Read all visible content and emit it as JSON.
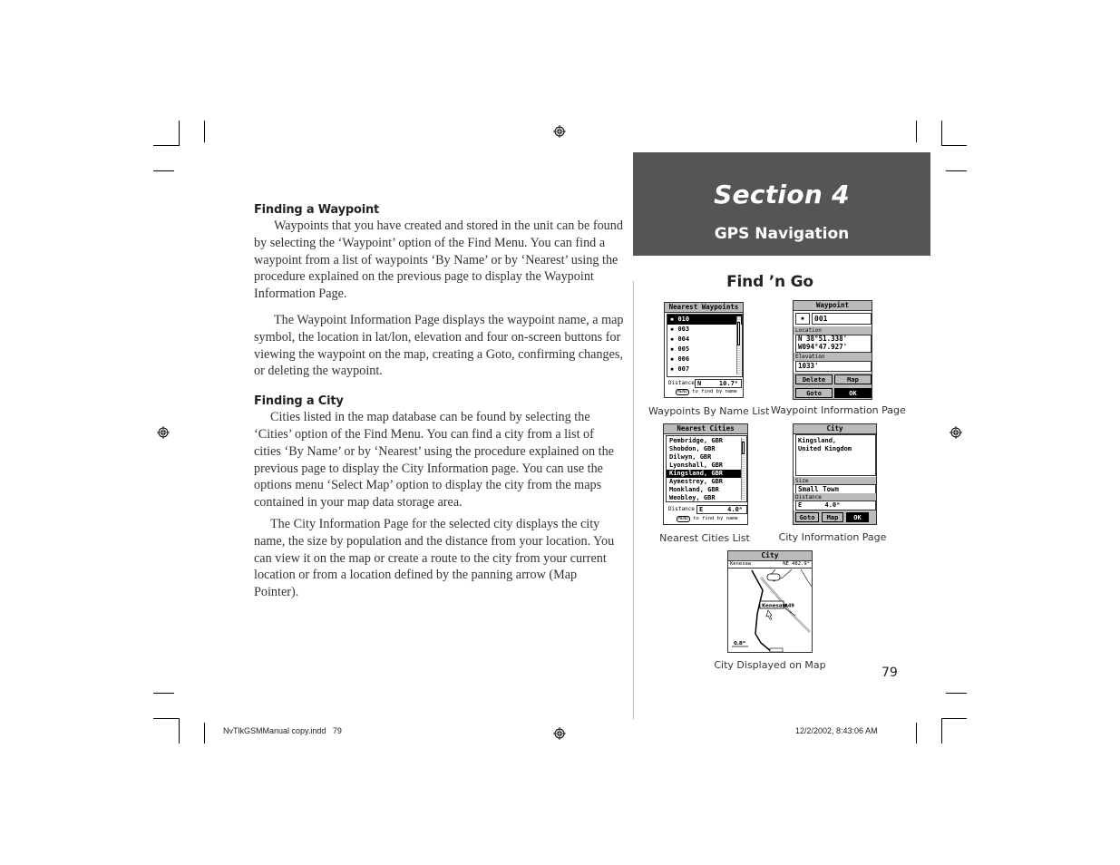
{
  "left_column": {
    "sections": [
      {
        "heading": "Finding a Waypoint",
        "paragraphs": [
          "Waypoints that you have created and stored in the unit can be found by selecting the ‘Waypoint’ option of the Find Menu.  You can find a waypoint from a list of waypoints ‘By Name’ or by ‘Nearest’ using the procedure explained on the previous page to display the Waypoint Information Page.",
          "The Waypoint Information Page displays the waypoint name, a map symbol, the location in lat/lon, elevation and four on-screen buttons for viewing the waypoint on the map, creating a Goto, confirming changes, or deleting the waypoint."
        ]
      },
      {
        "heading": "Finding a City",
        "paragraphs": [
          "Cities listed in the map database can be found by selecting the ‘Cities’ option of the Find Menu.  You can find a city from a list of cities ‘By Name’ or by ‘Nearest’ using the procedure explained on the previous page to display the City Information page.  You can use the options menu ‘Select Map’ option to display the city from the maps contained in your map data storage area.",
          "The City Information Page for the selected city displays the city name, the size by population and the distance from your location.  You can view it on the map or create a route to the city from your current location or from a location defined by the panning arrow (Map Pointer)."
        ]
      }
    ]
  },
  "section_tab": {
    "title": "Section 4",
    "subtitle": "GPS Navigation",
    "background": "#555555"
  },
  "figures": {
    "heading": "Find ’n Go",
    "nearest_waypoints": {
      "caption": "Waypoints By Name List",
      "title": "Nearest Waypoints",
      "items": [
        "010",
        "003",
        "004",
        "005",
        "006",
        "007"
      ],
      "selected_index": 0,
      "distance_label": "Distance",
      "distance_dir": "N",
      "distance_value": "10.7ᵐ",
      "hint_key": "MENU",
      "hint_text": "to find by name"
    },
    "waypoint_info": {
      "caption": "Waypoint Information Page",
      "title": "Waypoint",
      "name": "001",
      "location_label": "Location",
      "lat": "N  38°51.338'",
      "lon": "W094°47.927'",
      "elevation_label": "Elevation",
      "elevation": "1033'",
      "buttons": [
        "Delete",
        "Map",
        "Goto",
        "OK"
      ]
    },
    "nearest_cities": {
      "caption": "Nearest Cities List",
      "title": "Nearest Cities",
      "items": [
        "Pembridge, GBR",
        "Shobdon, GBR",
        "Dilwyn, GBR",
        "Lyonshall, GBR",
        "Kingsland, GBR",
        "Aymestrey, GBR",
        "Monkland, GBR",
        "Weobley, GBR"
      ],
      "selected_index": 4,
      "distance_label": "Distance",
      "distance_dir": "E",
      "distance_value": "4.0ᵐ",
      "hint_key": "MENU",
      "hint_text": "to find by name"
    },
    "city_info": {
      "caption": "City Information Page",
      "title": "City",
      "name": "Kingsland, United Kingdom",
      "size_label": "Size",
      "size": "Small Town",
      "distance_label": "Distance",
      "distance": "E      4.0ᵐ",
      "buttons": [
        "Goto",
        "Map",
        "OK"
      ]
    },
    "city_map": {
      "caption": "City Displayed on Map",
      "title": "City",
      "left_field": "Kenesaw",
      "right_field": "NE  482.9ᵐ",
      "city_label": "Kenesaw",
      "road_label": "A49",
      "scale": "0.8ᵐ"
    }
  },
  "page_number": "79",
  "slug": {
    "file": "NvTlkGSMManual copy.indd   79",
    "timestamp": "12/2/2002, 8:43:06 AM"
  }
}
